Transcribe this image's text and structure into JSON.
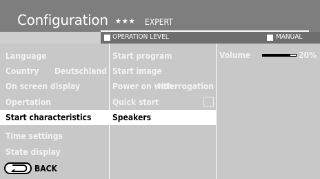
{
  "header": {
    "title": "Configuration",
    "stars": "★★★",
    "level_name": "EXPERT",
    "operation_level_label": "OPERATION LEVEL",
    "manual_label": "MANUAL"
  },
  "menu": [
    {
      "label": "Language",
      "value": "",
      "selected": false
    },
    {
      "label": "Country",
      "value": "Deutschland",
      "selected": false
    },
    {
      "label": "On screen display",
      "value": "",
      "selected": false
    },
    {
      "label": "Opertation",
      "value": "",
      "selected": false
    },
    {
      "label": "Start characteristics",
      "value": "",
      "selected": true
    },
    {
      "label": "Time settings",
      "value": "",
      "selected": false
    },
    {
      "label": "State display",
      "value": "",
      "selected": false
    }
  ],
  "submenu": [
    {
      "label": "Start program",
      "value": "",
      "selected": false
    },
    {
      "label": "Start image",
      "value": "",
      "selected": false
    },
    {
      "label": "Power on with",
      "value": "Interrogation",
      "selected": false
    },
    {
      "label": "Quick start",
      "checkbox": true,
      "checked": false,
      "selected": false
    },
    {
      "label": "Speakers",
      "value": "",
      "selected": true
    }
  ],
  "detail": {
    "volume_label": "Volume",
    "volume_percent": 20,
    "volume_text": "20%"
  },
  "footer": {
    "back_label": "BACK"
  },
  "colors": {
    "header_bg": "#7e7e7e",
    "level_bar_bg": "#6e6e6e",
    "panel_bg": "#c8c8c8",
    "selected_bg": "#ffffff"
  }
}
